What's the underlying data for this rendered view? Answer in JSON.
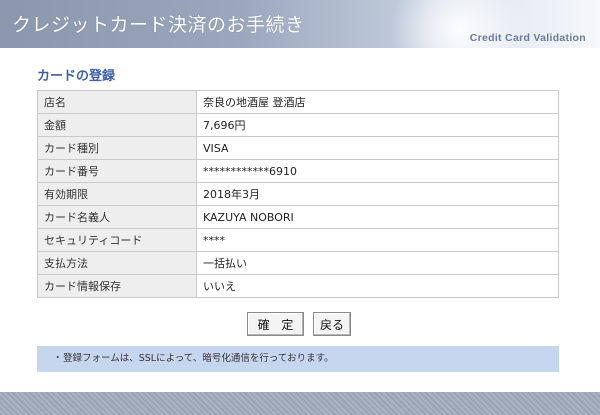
{
  "header": {
    "title": "クレジットカード決済のお手続き",
    "subtitle": "Credit Card Validation"
  },
  "section_title": "カードの登録",
  "rows": [
    {
      "label": "店名",
      "value": "奈良の地酒屋 登酒店"
    },
    {
      "label": "金額",
      "value": "7,696円"
    },
    {
      "label": "カード種別",
      "value": "VISA"
    },
    {
      "label": "カード番号",
      "value": "************6910"
    },
    {
      "label": "有効期限",
      "value": "2018年3月"
    },
    {
      "label": "カード名義人",
      "value": "KAZUYA NOBORI"
    },
    {
      "label": "セキュリティコード",
      "value": "****"
    },
    {
      "label": "支払方法",
      "value": "一括払い"
    },
    {
      "label": "カード情報保存",
      "value": "いいえ"
    }
  ],
  "buttons": {
    "confirm": "確 定",
    "back": "戻る"
  },
  "note": {
    "bullet": "・",
    "text": "登録フォームは、SSLによって、暗号化通信を行っております。"
  },
  "colors": {
    "accent": "#3b5fa8",
    "note_bg": "#c7d6ef",
    "label_bg": "#eeeeee"
  }
}
